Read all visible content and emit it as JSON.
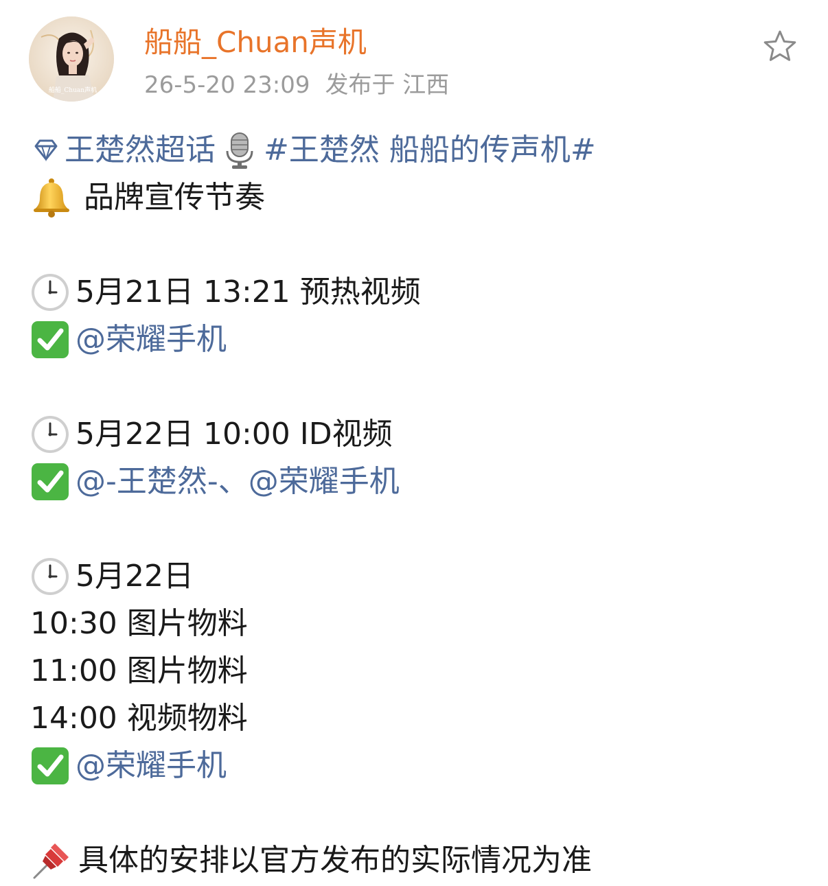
{
  "header": {
    "username": "船船_Chuan声机",
    "time": "26-5-20 23:09",
    "location": "发布于 江西",
    "avatar_caption": "船船_Chuan声机"
  },
  "post": {
    "supertopic": "王楚然超话",
    "hashtag": "#王楚然 船船的传声机#",
    "title": "品牌宣传节奏",
    "block1": {
      "time": "5月21日 13:21 预热视频",
      "accounts": [
        "@荣耀手机"
      ]
    },
    "block2": {
      "time": "5月22日 10:00 ID视频",
      "accounts": [
        "@-王楚然-",
        "、",
        "@荣耀手机"
      ]
    },
    "block3": {
      "time": "5月22日",
      "items": [
        "10:30 图片物料",
        "11:00 图片物料",
        "14:00 视频物料"
      ],
      "accounts": [
        "@荣耀手机"
      ]
    },
    "note": "具体的安排以官方发布的实际情况为准"
  },
  "icons": {
    "supertopic": "diamond-icon",
    "mic": "microphone-icon",
    "bell": "bell-icon",
    "clock": "clock-icon",
    "check": "checkmark-icon",
    "pin": "pushpin-icon",
    "favorite": "star-icon"
  },
  "colors": {
    "username": "#e8742a",
    "link": "#4d6a9a",
    "meta": "#9b9b9b",
    "check_bg": "#4bb543",
    "bell": "#f0b12a",
    "pin": "#d83a3a"
  }
}
